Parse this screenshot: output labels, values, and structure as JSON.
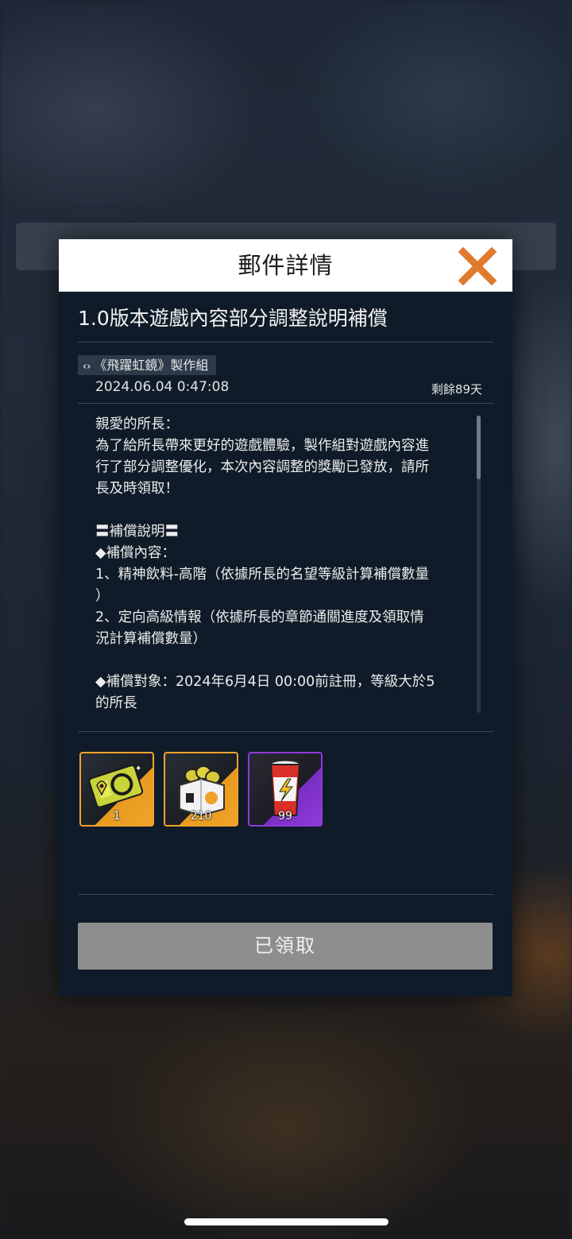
{
  "modal": {
    "title": "郵件詳情",
    "close_icon": "close-x-icon",
    "accent_color": "#E07A2E"
  },
  "mail": {
    "subject": "1.0版本遊戲內容部分調整說明補償",
    "sender_icon": "double-chevron-icon",
    "sender": "《飛躍虹鏡》製作組",
    "date": "2024.06.04  0:47:08",
    "expire": "剩餘89天",
    "body_lines": [
      "親愛的所長：",
      "為了給所長帶來更好的遊戲體驗，製作組對遊戲內容進",
      "行了部分調整優化，本次內容調整的獎勵已發放，請所",
      "長及時領取！",
      "",
      "〓補償說明〓",
      "◆補償內容：",
      "1、精神飲料-高階（依據所長的名望等級計算補償數量",
      "）",
      "2、定向高級情報（依據所長的章節通關進度及領取情",
      "況計算補償數量）",
      "",
      "◆補償對象：2024年6月4日 00:00前註冊，等級大於5",
      "的所長"
    ]
  },
  "rewards": [
    {
      "icon": "ticket-icon",
      "count": "1",
      "rarity_color": "#F0A32A"
    },
    {
      "icon": "gift-box-icon",
      "count": "210",
      "rarity_color": "#F0A32A"
    },
    {
      "icon": "drink-cup-icon",
      "count": "99",
      "rarity_color": "#8C3BD9"
    }
  ],
  "claim_button": {
    "label": "已領取",
    "state": "claimed"
  }
}
